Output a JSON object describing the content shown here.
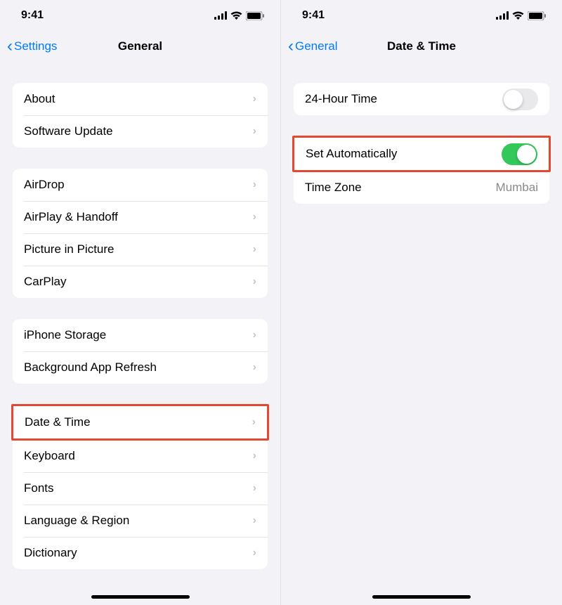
{
  "status": {
    "time": "9:41"
  },
  "left": {
    "back_label": "Settings",
    "title": "General",
    "groups": [
      {
        "rows": [
          {
            "label": "About"
          },
          {
            "label": "Software Update"
          }
        ]
      },
      {
        "rows": [
          {
            "label": "AirDrop"
          },
          {
            "label": "AirPlay & Handoff"
          },
          {
            "label": "Picture in Picture"
          },
          {
            "label": "CarPlay"
          }
        ]
      },
      {
        "rows": [
          {
            "label": "iPhone Storage"
          },
          {
            "label": "Background App Refresh"
          }
        ]
      },
      {
        "rows": [
          {
            "label": "Date & Time",
            "highlight": true
          },
          {
            "label": "Keyboard"
          },
          {
            "label": "Fonts"
          },
          {
            "label": "Language & Region"
          },
          {
            "label": "Dictionary"
          }
        ]
      }
    ]
  },
  "right": {
    "back_label": "General",
    "title": "Date & Time",
    "groups": [
      {
        "rows": [
          {
            "label": "24-Hour Time",
            "type": "toggle",
            "on": false
          }
        ]
      },
      {
        "rows": [
          {
            "label": "Set Automatically",
            "type": "toggle",
            "on": true,
            "highlight": true
          },
          {
            "label": "Time Zone",
            "type": "value",
            "value": "Mumbai"
          }
        ]
      }
    ]
  }
}
